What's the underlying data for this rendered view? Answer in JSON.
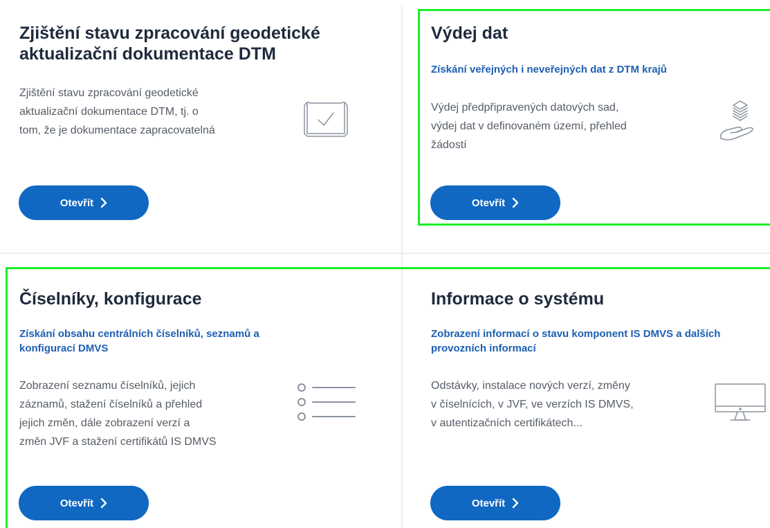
{
  "cards": [
    {
      "title_lines": [
        "Zjištění stavu zpracování geodetické",
        "aktualizační dokumentace DTM"
      ],
      "subtitle_lines": [],
      "desc_lines": [
        "Zjištění stavu zpracování geodetické",
        "aktualizační dokumentace DTM, tj. o",
        "tom, že je dokumentace zapracovatelná"
      ],
      "button_label": "Otevřít",
      "icon": "document-check-icon"
    },
    {
      "title_lines": [
        "Výdej dat"
      ],
      "subtitle_lines": [
        "Získání veřejných i neveřejných dat z DTM krajů"
      ],
      "desc_lines": [
        "Výdej předpřipravených datových sad,",
        "výdej dat v definovaném území, přehled",
        "žádostí"
      ],
      "button_label": "Otevřít",
      "icon": "hand-layers-icon"
    },
    {
      "title_lines": [
        "Číselníky, konfigurace"
      ],
      "subtitle_lines": [
        "Získání obsahu centrálních číselníků, seznamů a",
        "konfigurací DMVS"
      ],
      "desc_lines": [
        "Zobrazení seznamu číselníků, jejich",
        "záznamů, stažení číselníků a přehled",
        "jejich změn, dále zobrazení verzí a",
        "změn JVF a stažení certifikátů IS DMVS"
      ],
      "button_label": "Otevřít",
      "icon": "list-icon"
    },
    {
      "title_lines": [
        "Informace o systému"
      ],
      "subtitle_lines": [
        "Zobrazení informací o stavu komponent IS DMVS a dalších",
        "provozních informací"
      ],
      "desc_lines": [
        "Odstávky, instalace nových verzí, změny",
        "v číselnících, v JVF, ve verzích IS DMVS,",
        "v autentizačních certifikátech..."
      ],
      "button_label": "Otevřít",
      "icon": "monitor-icon"
    }
  ],
  "colors": {
    "title": "#1f2a3d",
    "subtitle": "#1c5fb3",
    "text": "#555c66",
    "button": "#1068c2",
    "highlight": "#1aee28",
    "divider": "#ececec"
  }
}
